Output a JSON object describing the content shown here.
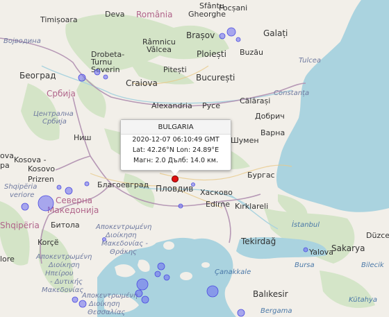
{
  "popup": {
    "title": "BULGARIA",
    "datetime": "2020-12-07 06:10:49 GMT",
    "coords": "Lat: 42.26°N Lon: 24.89°E",
    "details": "Магн: 2.0 Дълб: 14.0 км."
  },
  "labels": [
    {
      "id": "timisoara",
      "text": "Timișoara"
    },
    {
      "id": "deva",
      "text": "Deva"
    },
    {
      "id": "romania",
      "text": "România"
    },
    {
      "id": "sfantu",
      "text": "Sfântu"
    },
    {
      "id": "gheorghe",
      "text": "Gheorghe"
    },
    {
      "id": "focsani",
      "text": "Focșani"
    },
    {
      "id": "galati",
      "text": "Galați"
    },
    {
      "id": "brasov",
      "text": "Brașov"
    },
    {
      "id": "vojvodina",
      "text": "Војводина"
    },
    {
      "id": "ramnicu",
      "text": "Râmnicu"
    },
    {
      "id": "valcea",
      "text": "Vâlcea"
    },
    {
      "id": "ploiesti",
      "text": "Ploiești"
    },
    {
      "id": "buzau",
      "text": "Buzău"
    },
    {
      "id": "drobeta",
      "text": "Drobeta-"
    },
    {
      "id": "turnu",
      "text": "Turnu"
    },
    {
      "id": "severin",
      "text": "Severin"
    },
    {
      "id": "tulcea",
      "text": "Tulcea"
    },
    {
      "id": "beograd",
      "text": "Београд"
    },
    {
      "id": "pitesti",
      "text": "Pitești"
    },
    {
      "id": "bucuresti",
      "text": "București"
    },
    {
      "id": "craiova",
      "text": "Craiova"
    },
    {
      "id": "srbija",
      "text": "Србија"
    },
    {
      "id": "constanta",
      "text": "Constanța"
    },
    {
      "id": "calarasi",
      "text": "Călărași"
    },
    {
      "id": "alexandria",
      "text": "Alexandria"
    },
    {
      "id": "ruse",
      "text": "Русе"
    },
    {
      "id": "centralna",
      "text": "Централна"
    },
    {
      "id": "srbija2",
      "text": "Србија"
    },
    {
      "id": "dobrich",
      "text": "Добрич"
    },
    {
      "id": "varna",
      "text": "Варна"
    },
    {
      "id": "nish",
      "text": "Ниш"
    },
    {
      "id": "shumen",
      "text": "Шумен"
    },
    {
      "id": "kosovo1",
      "text": "Kosova -"
    },
    {
      "id": "kosovo2",
      "text": "Kosovo"
    },
    {
      "id": "ova",
      "text": "ova"
    },
    {
      "id": "pa",
      "text": "pa"
    },
    {
      "id": "prizren",
      "text": "Prizren"
    },
    {
      "id": "blagoevgrad",
      "text": "Благоевград"
    },
    {
      "id": "burgas",
      "text": "Бургас"
    },
    {
      "id": "plovdiv",
      "text": "Пловдив"
    },
    {
      "id": "haskovo",
      "text": "Хасково"
    },
    {
      "id": "shqiperia_v",
      "text": "Shqipëria"
    },
    {
      "id": "verior",
      "text": "veriore"
    },
    {
      "id": "severna",
      "text": "Северна"
    },
    {
      "id": "makedonija",
      "text": "Македонија"
    },
    {
      "id": "edirne",
      "text": "Edirne"
    },
    {
      "id": "kirklareli",
      "text": "Kırklareli"
    },
    {
      "id": "shqiperia",
      "text": "Shqipëria"
    },
    {
      "id": "bitola",
      "text": "Битола"
    },
    {
      "id": "apok1",
      "text": "Αποκεντρωμένη"
    },
    {
      "id": "apok2",
      "text": "Διοίκηση"
    },
    {
      "id": "apok3",
      "text": "Μακεδονίας -"
    },
    {
      "id": "apok4",
      "text": "Θράκης"
    },
    {
      "id": "istanbul",
      "text": "İstanbul"
    },
    {
      "id": "korce",
      "text": "Korçë"
    },
    {
      "id": "tekirdag",
      "text": "Tekirdağ"
    },
    {
      "id": "sakarya",
      "text": "Sakarya"
    },
    {
      "id": "duzce",
      "text": "Düzce"
    },
    {
      "id": "lore",
      "text": "lore"
    },
    {
      "id": "yalova",
      "text": "Yalova"
    },
    {
      "id": "bursa",
      "text": "Bursa"
    },
    {
      "id": "bilecik",
      "text": "Bilecik"
    },
    {
      "id": "apokw1",
      "text": "Αποκεντρωμένη"
    },
    {
      "id": "apokw2",
      "text": "Διοίκηση"
    },
    {
      "id": "apokw3",
      "text": "Ηπείρου"
    },
    {
      "id": "apokw4",
      "text": "- Δυτικής"
    },
    {
      "id": "apokw5",
      "text": "Μακεδονίας"
    },
    {
      "id": "canakkale",
      "text": "Çanakkale"
    },
    {
      "id": "balikesir",
      "text": "Balıkesir"
    },
    {
      "id": "kutahya",
      "text": "Kütahya"
    },
    {
      "id": "apoks1",
      "text": "Αποκεντρωμένη"
    },
    {
      "id": "apoks2",
      "text": "Διοίκηση"
    },
    {
      "id": "apoks3",
      "text": "Θεσσαλίας"
    },
    {
      "id": "bergama",
      "text": "Bergama"
    }
  ],
  "colors": {
    "sea": "#aad3df",
    "land": "#f2efe9",
    "border": "#b08fb0",
    "quake": "#6a6af0",
    "selected": "#e01010"
  }
}
